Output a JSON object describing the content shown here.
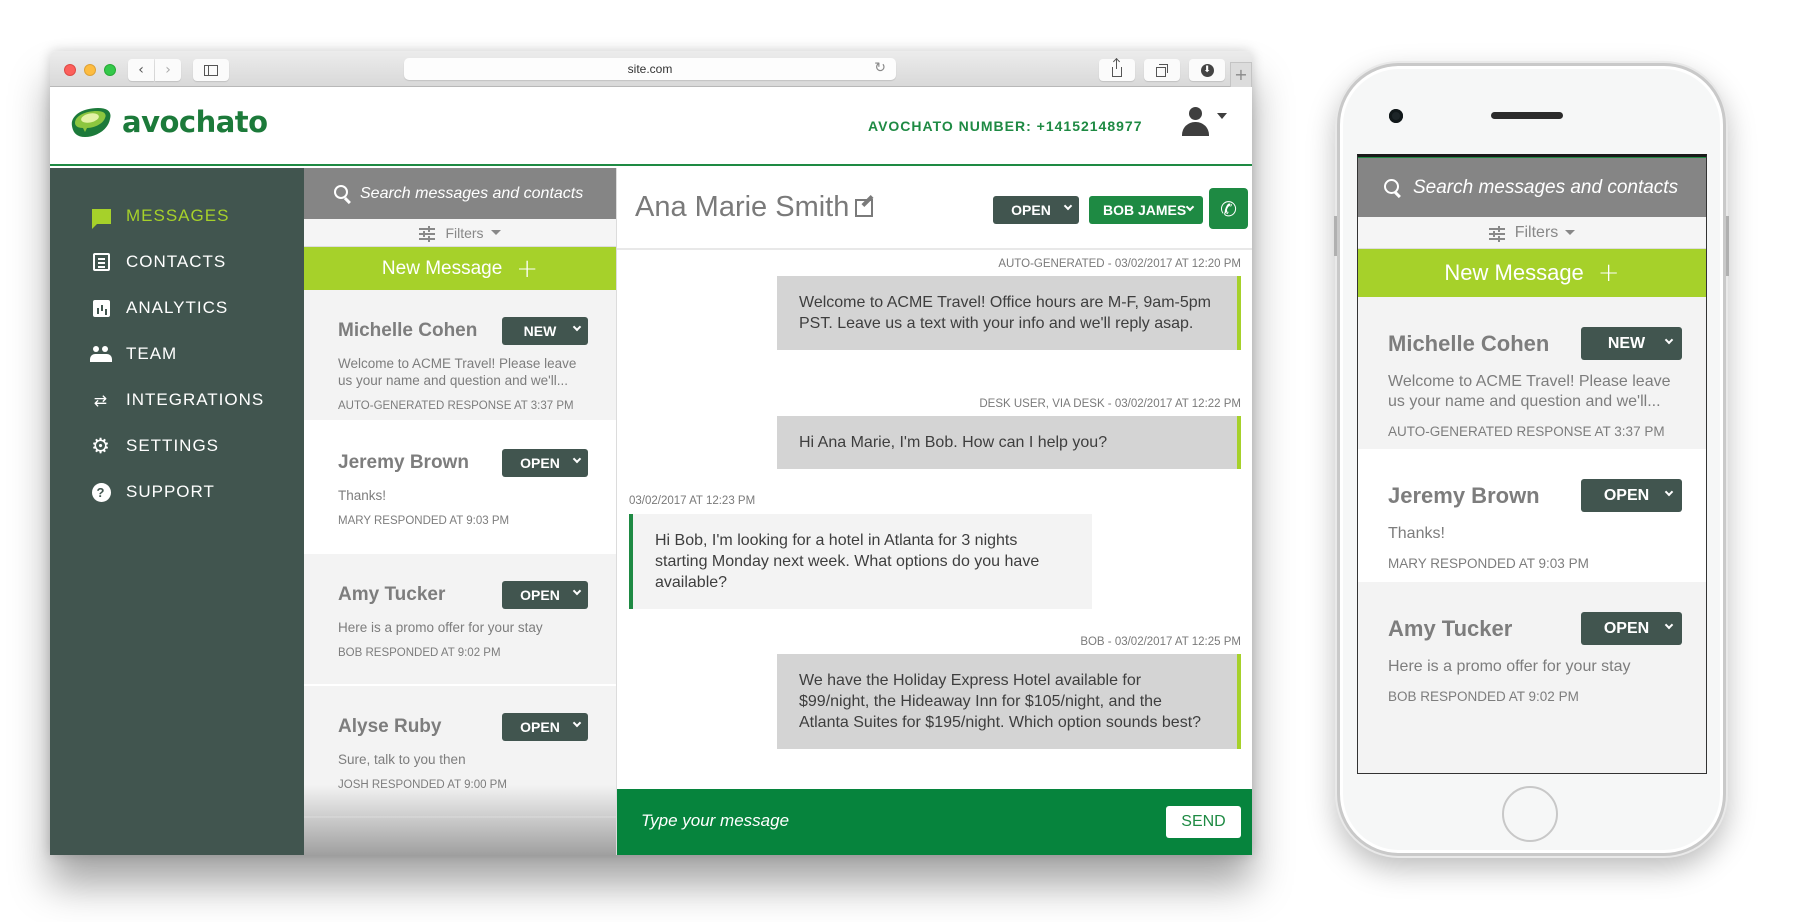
{
  "browser": {
    "url": "site.com",
    "buttons": {
      "back": "‹",
      "forward": "›",
      "reload_icon": "reload-icon",
      "share_icon": "share-icon",
      "tabs_icon": "tabs-icon",
      "download_icon": "download-icon",
      "new_tab": "+"
    }
  },
  "app": {
    "brand": "avochato",
    "number_label": "AVOCHATO NUMBER: +14152148977",
    "colors": {
      "primary_green": "#1e8a43",
      "lime": "#a6d12a",
      "sidebar": "#41554f",
      "search_gray": "#858585"
    }
  },
  "sidebar": {
    "items": [
      {
        "label": "MESSAGES",
        "icon": "chat-icon",
        "active": true
      },
      {
        "label": "CONTACTS",
        "icon": "contacts-icon",
        "active": false
      },
      {
        "label": "ANALYTICS",
        "icon": "analytics-icon",
        "active": false
      },
      {
        "label": "TEAM",
        "icon": "team-icon",
        "active": false
      },
      {
        "label": "INTEGRATIONS",
        "icon": "integrations-icon",
        "active": false
      },
      {
        "label": "SETTINGS",
        "icon": "gear-icon",
        "active": false
      },
      {
        "label": "SUPPORT",
        "icon": "help-icon",
        "active": false
      }
    ]
  },
  "list": {
    "search_placeholder": "Search messages and contacts",
    "filters_label": "Filters",
    "new_message_label": "New Message",
    "new_message_icon": "+",
    "conversations": [
      {
        "name": "Michelle Cohen",
        "status": "NEW",
        "preview": "Welcome to ACME Travel! Please leave us your name and question and we'll...",
        "meta": "AUTO-GENERATED RESPONSE AT 3:37 PM"
      },
      {
        "name": "Jeremy Brown",
        "status": "OPEN",
        "preview": "Thanks!",
        "meta": "MARY RESPONDED AT 9:03 PM"
      },
      {
        "name": "Amy Tucker",
        "status": "OPEN",
        "preview": "Here is a promo offer for your stay",
        "meta": "BOB RESPONDED AT 9:02 PM"
      },
      {
        "name": "Alyse Ruby",
        "status": "OPEN",
        "preview": "Sure, talk to you then",
        "meta": "JOSH RESPONDED AT 9:00 PM"
      }
    ]
  },
  "conversation": {
    "contact_name": "Ana Marie Smith",
    "status": "OPEN",
    "assignee": "BOB JAMES",
    "call_icon": "✆",
    "messages": [
      {
        "direction": "out",
        "meta": "AUTO-GENERATED - 03/02/2017 AT 12:20 PM",
        "text": "Welcome to ACME Travel! Office hours are M-F, 9am-5pm PST. Leave us a text with your info and we'll reply asap."
      },
      {
        "direction": "out",
        "meta": "DESK USER, VIA DESK - 03/02/2017 AT 12:22 PM",
        "text": "Hi Ana Marie, I'm Bob. How can I help you?"
      },
      {
        "direction": "in",
        "meta": "03/02/2017 AT 12:23 PM",
        "text": "Hi Bob, I'm looking for a hotel in Atlanta for 3 nights starting Monday next week. What options do you have available?"
      },
      {
        "direction": "out",
        "meta": "BOB - 03/02/2017 AT 12:25 PM",
        "text": "We have the Holiday Express Hotel available for $99/night, the Hideaway Inn for $105/night, and the Atlanta Suites for $195/night. Which option sounds best?"
      }
    ],
    "compose_placeholder": "Type your message",
    "send_label": "SEND"
  },
  "phone": {
    "search_placeholder": "Search messages and contacts",
    "filters_label": "Filters",
    "new_message_label": "New Message",
    "new_message_icon": "+",
    "conversations": [
      {
        "name": "Michelle Cohen",
        "status": "NEW",
        "preview": "Welcome to ACME Travel! Please leave us your name and question and we'll...",
        "meta": "AUTO-GENERATED RESPONSE AT 3:37 PM"
      },
      {
        "name": "Jeremy Brown",
        "status": "OPEN",
        "preview": "Thanks!",
        "meta": "MARY RESPONDED AT 9:03 PM"
      },
      {
        "name": "Amy Tucker",
        "status": "OPEN",
        "preview": "Here is a promo offer for your stay",
        "meta": "BOB RESPONDED AT 9:02 PM"
      }
    ]
  }
}
